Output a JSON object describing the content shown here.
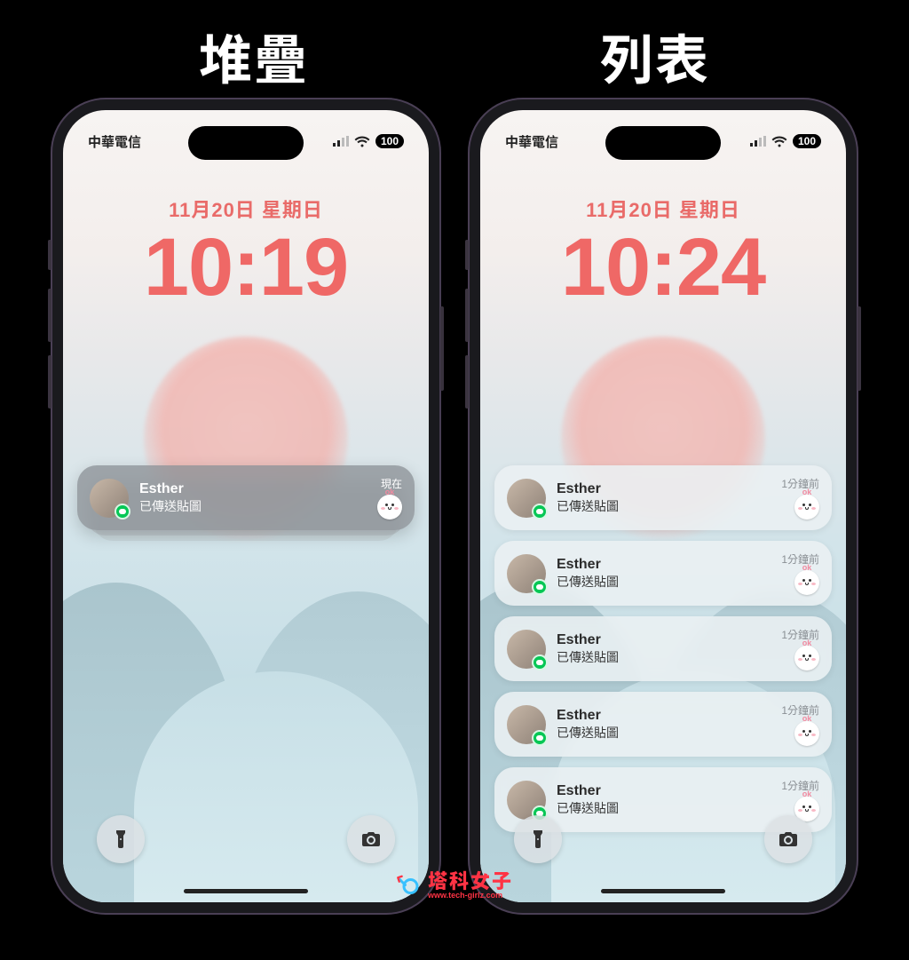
{
  "labels": {
    "left": "堆疊",
    "right": "列表"
  },
  "status": {
    "carrier": "中華電信",
    "battery": "100"
  },
  "left_screen": {
    "date": "11月20日 星期日",
    "time": "10:19",
    "notification": {
      "sender": "Esther",
      "message": "已傳送貼圖",
      "time": "現在"
    }
  },
  "right_screen": {
    "date": "11月20日 星期日",
    "time": "10:24",
    "notifications": [
      {
        "sender": "Esther",
        "message": "已傳送貼圖",
        "time": "1分鐘前"
      },
      {
        "sender": "Esther",
        "message": "已傳送貼圖",
        "time": "1分鐘前"
      },
      {
        "sender": "Esther",
        "message": "已傳送貼圖",
        "time": "1分鐘前"
      },
      {
        "sender": "Esther",
        "message": "已傳送貼圖",
        "time": "1分鐘前"
      },
      {
        "sender": "Esther",
        "message": "已傳送貼圖",
        "time": "1分鐘前"
      }
    ]
  },
  "watermark": {
    "cn": "塔科女子",
    "en": "www.tech-girlz.com"
  }
}
